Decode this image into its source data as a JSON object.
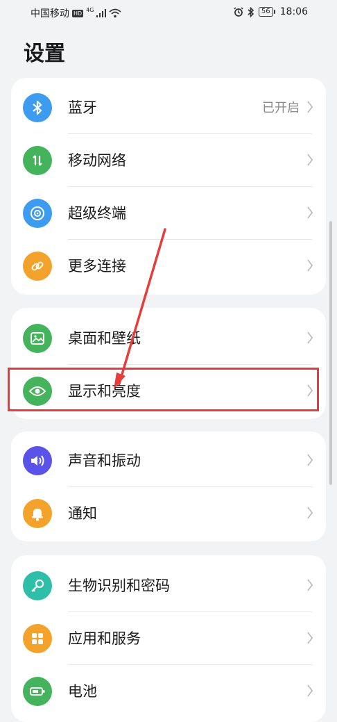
{
  "status_bar": {
    "carrier": "中国移动",
    "hd_badge": "HD",
    "network": "4G",
    "battery": "56",
    "time": "18:06"
  },
  "page": {
    "title": "设置"
  },
  "groups": [
    {
      "items": [
        {
          "label": "蓝牙",
          "value": "已开启",
          "icon": "bluetooth-icon",
          "color": "#3d9cf0"
        },
        {
          "label": "移动网络",
          "icon": "mobile-network-icon",
          "color": "#44b35c"
        },
        {
          "label": "超级终端",
          "icon": "super-device-icon",
          "color": "#3d9cf0"
        },
        {
          "label": "更多连接",
          "icon": "link-icon",
          "color": "#f3a32c"
        }
      ]
    },
    {
      "items": [
        {
          "label": "桌面和壁纸",
          "icon": "wallpaper-icon",
          "color": "#44b35c"
        },
        {
          "label": "显示和亮度",
          "icon": "eye-icon",
          "color": "#44b35c"
        }
      ]
    },
    {
      "items": [
        {
          "label": "声音和振动",
          "icon": "speaker-icon",
          "color": "#5b53e8"
        },
        {
          "label": "通知",
          "icon": "bell-icon",
          "color": "#f3a32c"
        }
      ]
    },
    {
      "items": [
        {
          "label": "生物识别和密码",
          "icon": "key-icon",
          "color": "#2fbfa8"
        },
        {
          "label": "应用和服务",
          "icon": "apps-icon",
          "color": "#f3a32c"
        },
        {
          "label": "电池",
          "icon": "battery-icon",
          "color": "#44b35c"
        }
      ]
    }
  ],
  "annotation": {
    "highlight_color": "#e53c3c"
  }
}
